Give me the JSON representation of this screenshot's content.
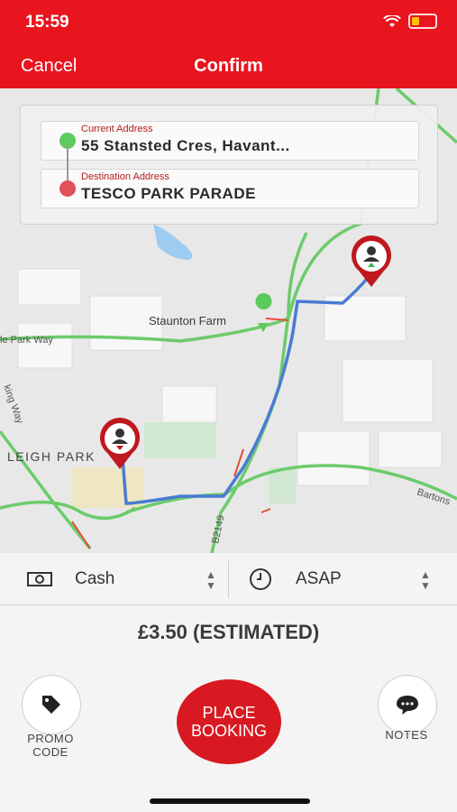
{
  "status": {
    "time": "15:59"
  },
  "nav": {
    "cancel_label": "Cancel",
    "title": "Confirm"
  },
  "addresses": {
    "pickup_label": "Current Address",
    "pickup_value": "55 Stansted Cres, Havant...",
    "destination_label": "Destination Address",
    "destination_value": "TESCO PARK PARADE"
  },
  "map": {
    "place_labels": [
      "Staunton Farm",
      "LEIGH PARK",
      "le Park Way",
      "Bartons",
      "B2149",
      "king Way"
    ]
  },
  "payment": {
    "method": "Cash",
    "payment_icon": "cash-icon"
  },
  "timing": {
    "value": "ASAP",
    "timing_icon": "clock-icon"
  },
  "fare": {
    "text": "£3.50 (ESTIMATED)"
  },
  "actions": {
    "promo_label_line1": "PROMO",
    "promo_label_line2": "CODE",
    "place_line1": "PLACE",
    "place_line2": "BOOKING",
    "notes_label": "NOTES"
  },
  "colors": {
    "brand_red": "#e8141e",
    "pickup_dot": "#5ccd5c",
    "destination_dot": "#e0525a",
    "route": "#4a7bd1"
  }
}
